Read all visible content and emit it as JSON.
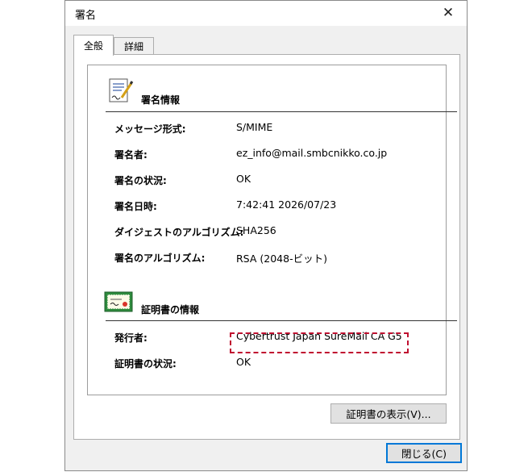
{
  "window": {
    "title": "署名",
    "close_glyph": "✕"
  },
  "tabs": [
    {
      "label": "全般",
      "active": true
    },
    {
      "label": "詳細",
      "active": false
    }
  ],
  "signature_section": {
    "heading": "署名情報",
    "icon": "signed-document-icon",
    "rows": [
      {
        "label": "メッセージ形式:",
        "value": "S/MIME"
      },
      {
        "label": "署名者:",
        "value": "ez_info@mail.smbcnikko.co.jp"
      },
      {
        "label": "署名の状況:",
        "value": "OK"
      },
      {
        "label": "署名日時:",
        "value": "7:42:41 2026/07/23"
      },
      {
        "label": "ダイジェストのアルゴリズム:",
        "value": "SHA256"
      },
      {
        "label": "署名のアルゴリズム:",
        "value": "RSA (2048-ビット)"
      }
    ]
  },
  "certificate_section": {
    "heading": "証明書の情報",
    "icon": "certificate-icon",
    "rows": [
      {
        "label": "発行者:",
        "value": "Cybertrust Japan SureMail CA G5"
      },
      {
        "label": "証明書の状況:",
        "value": "OK"
      }
    ]
  },
  "buttons": {
    "view_certificate": "証明書の表示(V)...",
    "close": "閉じる(C)"
  },
  "colors": {
    "highlight": "#c01030",
    "default_button_border": "#0078d7"
  }
}
